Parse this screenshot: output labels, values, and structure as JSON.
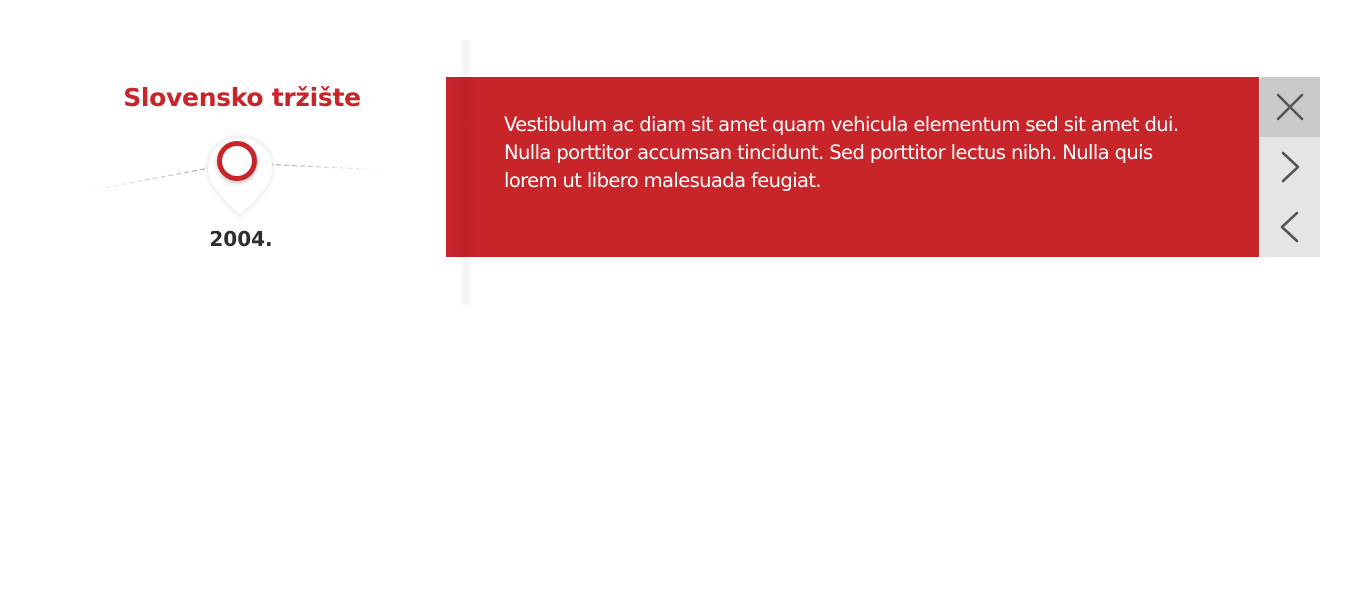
{
  "timeline_marker": {
    "title": "Slovensko tržište",
    "year": "2004."
  },
  "info_panel": {
    "text": "Vestibulum ac diam sit amet quam vehicula elementum sed sit amet dui. Nulla porttitor accumsan tincidunt. Sed porttitor lectus nibh. Nulla quis lorem ut libero malesuada feugiat."
  },
  "controls": {
    "close_icon": "close-icon",
    "next_icon": "chevron-right-icon",
    "prev_icon": "chevron-left-icon"
  },
  "colors": {
    "accent": "#c8252b",
    "year_text": "#2e2e2e",
    "button_bg": "#e5e5e5",
    "close_button_bg": "#cacaca",
    "icon": "#555555"
  }
}
